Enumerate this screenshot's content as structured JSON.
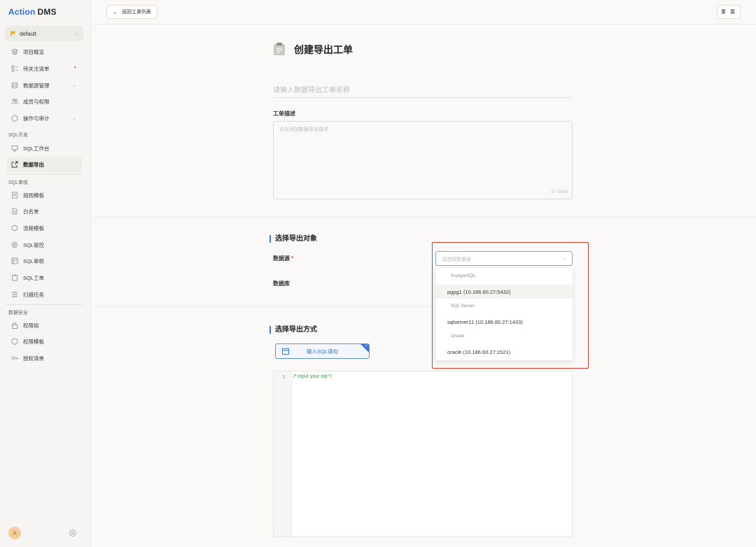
{
  "app": {
    "brand_a": "Action",
    "brand_b": "DMS"
  },
  "project": {
    "name": "default"
  },
  "nav": {
    "overview": "项目概览",
    "watchlist": "待关注清单",
    "datasource": "数据源管理",
    "members": "成员与权限",
    "audit": "操作与审计",
    "section_sql_dev": "SQL开发",
    "sql_workbench": "SQL工作台",
    "data_export": "数据导出",
    "section_sql_review": "SQL审核",
    "rule_template": "规则模板",
    "whitelist": "白名单",
    "flow_template": "流程模板",
    "sql_control": "SQL管控",
    "sql_audit": "SQL审核",
    "sql_ticket": "SQL工单",
    "scan_task": "扫描任务",
    "section_data_security": "数据安全",
    "perm_group": "权限组",
    "perm_template": "权限模板",
    "auth_list": "授权清单"
  },
  "user": {
    "avatar_letter": "A"
  },
  "topbar": {
    "back_label": "返回工单列表",
    "reset_label": "重 置"
  },
  "form": {
    "title": "创建导出工单",
    "name_placeholder": "请输入数据导出工单名称",
    "desc_label": "工单描述",
    "desc_placeholder": "点击添加数据导出描述",
    "desc_counter": "0 / 3000",
    "section_object": "选择导出对象",
    "datasource_label": "数据源",
    "datasource_placeholder": "请选择数据源",
    "database_label": "数据库",
    "section_method": "选择导出方式",
    "sql_button": "输入SQL语句",
    "editor_line": "1",
    "editor_code": "/* input your sql */"
  },
  "dropdown": {
    "groups": [
      {
        "label": "PostgreSQL",
        "option": "pgpg1 (10.186.60.27:5432)"
      },
      {
        "label": "SQL Server",
        "option": "sqlserver11 (10.186.60.27:1433)"
      },
      {
        "label": "Oracle",
        "option": "oracle (10.186.60.27:1521)"
      }
    ]
  },
  "colors": {
    "accent": "#2f6fd6",
    "highlight_box": "#e33b2b",
    "flag": "#f5b400"
  }
}
